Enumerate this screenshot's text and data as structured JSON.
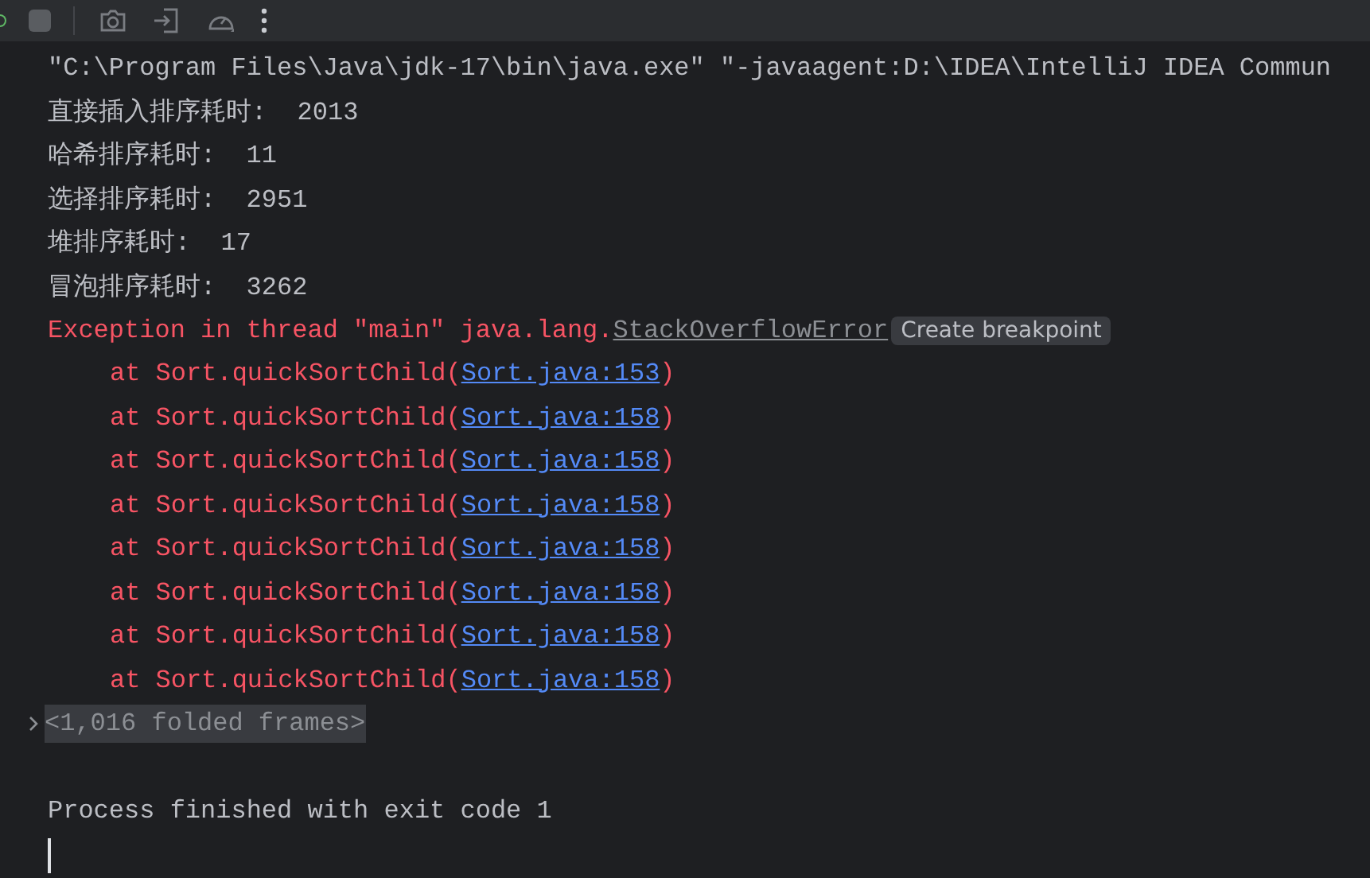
{
  "console_lines": [
    {
      "kind": "plain",
      "text": "\"C:\\Program Files\\Java\\jdk-17\\bin\\java.exe\" \"-javaagent:D:\\IDEA\\IntelliJ IDEA Commun"
    },
    {
      "kind": "plain",
      "text": "直接插入排序耗时:  2013"
    },
    {
      "kind": "plain",
      "text": "哈希排序耗时:  11"
    },
    {
      "kind": "plain",
      "text": "选择排序耗时:  2951"
    },
    {
      "kind": "plain",
      "text": "堆排序耗时:  17"
    },
    {
      "kind": "plain",
      "text": "冒泡排序耗时:  3262"
    },
    {
      "kind": "exception",
      "text": "Exception in thread \"main\" java.lang.",
      "link": "StackOverflowError",
      "hint": "Create breakpoint"
    },
    {
      "kind": "frame",
      "text": "at Sort.quickSortChild(",
      "link": "Sort.java:153",
      "end": ")"
    },
    {
      "kind": "frame",
      "text": "at Sort.quickSortChild(",
      "link": "Sort.java:158",
      "end": ")"
    },
    {
      "kind": "frame",
      "text": "at Sort.quickSortChild(",
      "link": "Sort.java:158",
      "end": ")"
    },
    {
      "kind": "frame",
      "text": "at Sort.quickSortChild(",
      "link": "Sort.java:158",
      "end": ")"
    },
    {
      "kind": "frame",
      "text": "at Sort.quickSortChild(",
      "link": "Sort.java:158",
      "end": ")"
    },
    {
      "kind": "frame",
      "text": "at Sort.quickSortChild(",
      "link": "Sort.java:158",
      "end": ")"
    },
    {
      "kind": "frame",
      "text": "at Sort.quickSortChild(",
      "link": "Sort.java:158",
      "end": ")"
    },
    {
      "kind": "frame",
      "text": "at Sort.quickSortChild(",
      "link": "Sort.java:158",
      "end": ")"
    },
    {
      "kind": "folded",
      "text": "<1,016 folded frames>",
      "expanded": false
    },
    {
      "kind": "blank"
    },
    {
      "kind": "plain",
      "text": "Process finished with exit code 1"
    }
  ]
}
